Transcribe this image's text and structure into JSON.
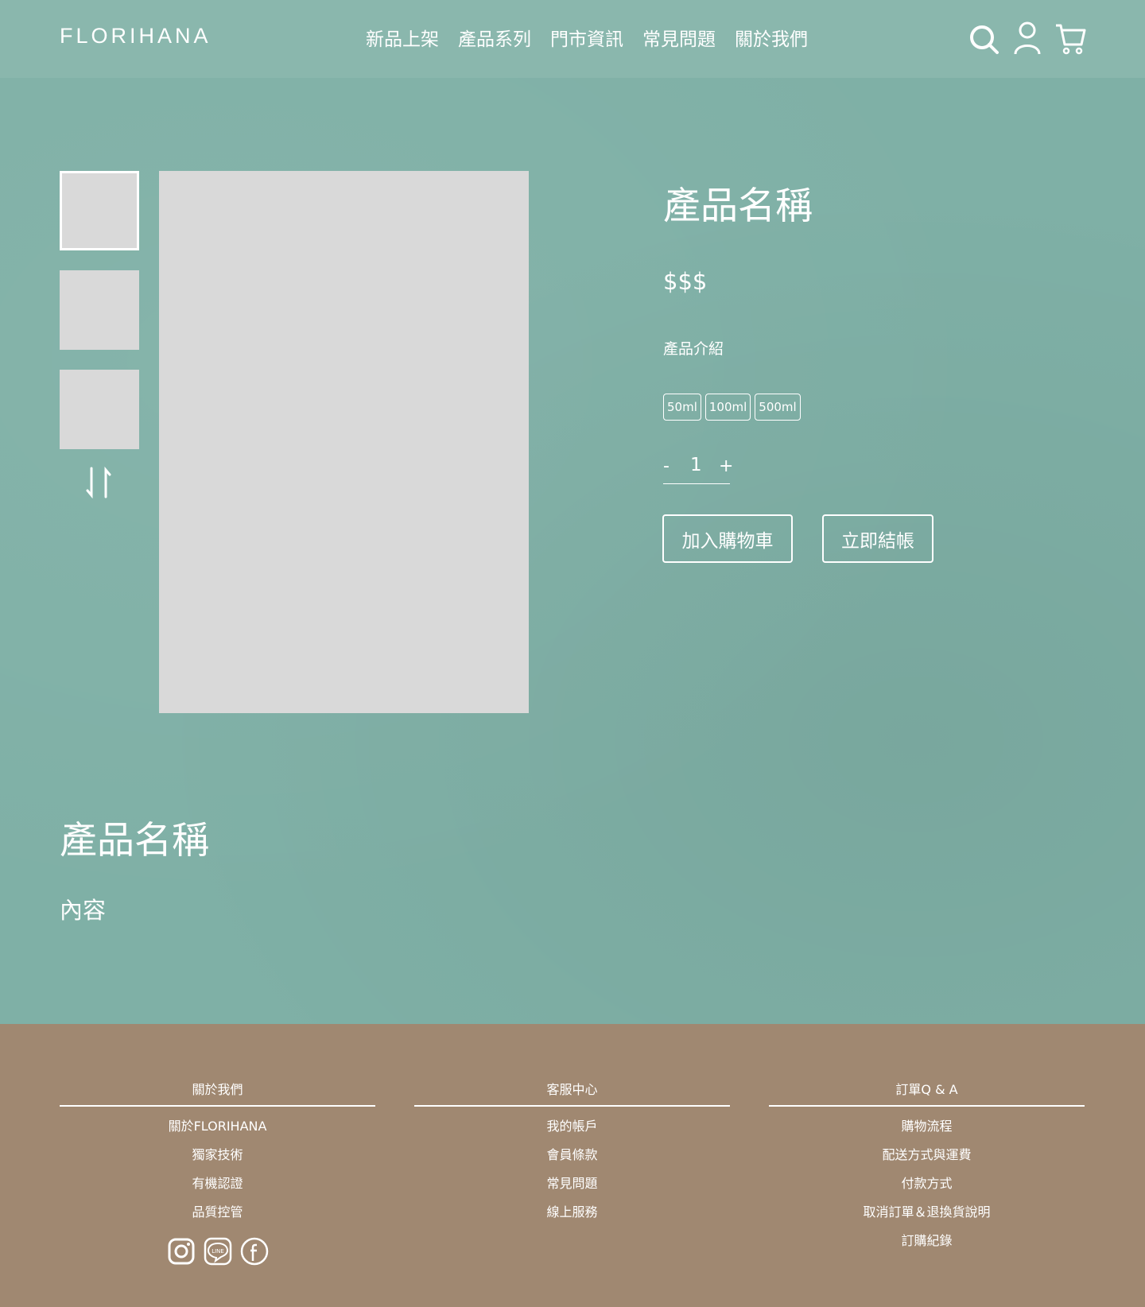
{
  "brand": {
    "logo": "FLORIHANA"
  },
  "nav": [
    "新品上架",
    "產品系列",
    "門市資訊",
    "常見問題",
    "關於我們"
  ],
  "header_icons": [
    "search-icon",
    "user-icon",
    "cart-icon"
  ],
  "product": {
    "title": "產品名稱",
    "price": "$$$",
    "intro": "產品介紹",
    "sizes": [
      "50ml",
      "100ml",
      "500ml"
    ],
    "quantity": {
      "minus": "-",
      "value": "1",
      "plus": "+"
    },
    "add_to_cart": "加入購物車",
    "checkout": "立即結帳"
  },
  "detail": {
    "title": "產品名稱",
    "content": "內容"
  },
  "footer": {
    "columns": [
      {
        "title": "關於我們",
        "items": [
          "關於FLORIHANA",
          "獨家技術",
          "有機認證",
          "品質控管"
        ]
      },
      {
        "title": "客服中心",
        "items": [
          "我的帳戶",
          "會員條款",
          "常見問題",
          "線上服務"
        ]
      },
      {
        "title": "訂單Q & A",
        "items": [
          "購物流程",
          "配送方式與運費",
          "付款方式",
          "取消訂單＆退換貨說明",
          "訂購紀錄"
        ]
      }
    ],
    "socials": [
      "instagram-icon",
      "line-icon",
      "facebook-icon"
    ]
  },
  "colors": {
    "header": "#8ab7ad",
    "main": "#7fb0a6",
    "footer": "#a08871",
    "placeholder": "#d9d9d9"
  }
}
